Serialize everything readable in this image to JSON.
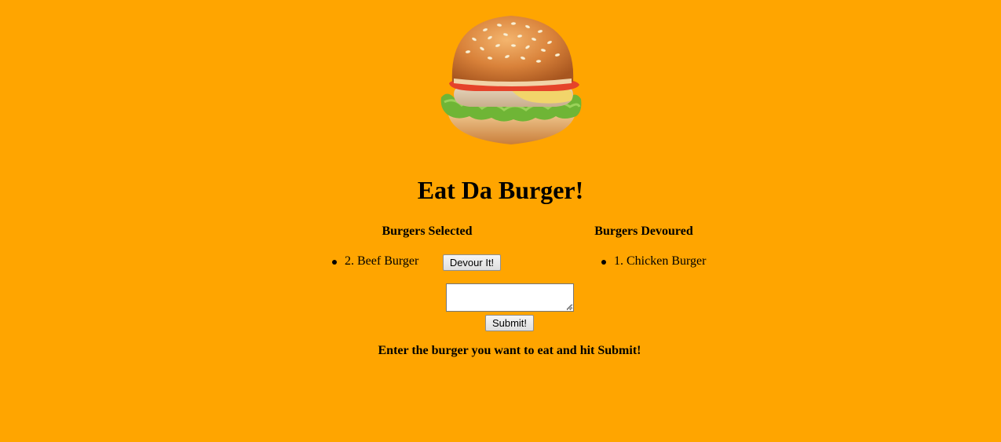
{
  "app": {
    "background_color": "#FFA500",
    "title": "Eat Da Burger!"
  },
  "logo": {
    "icon": "burger-icon"
  },
  "selected": {
    "heading": "Burgers Selected",
    "items": [
      {
        "label": "2. Beef Burger",
        "button_label": "Devour It!"
      }
    ]
  },
  "devoured": {
    "heading": "Burgers Devoured",
    "items": [
      {
        "label": "1. Chicken Burger"
      }
    ]
  },
  "form": {
    "input_value": "",
    "submit_label": "Submit!",
    "instructions": "Enter the burger you want to eat and hit Submit!"
  }
}
